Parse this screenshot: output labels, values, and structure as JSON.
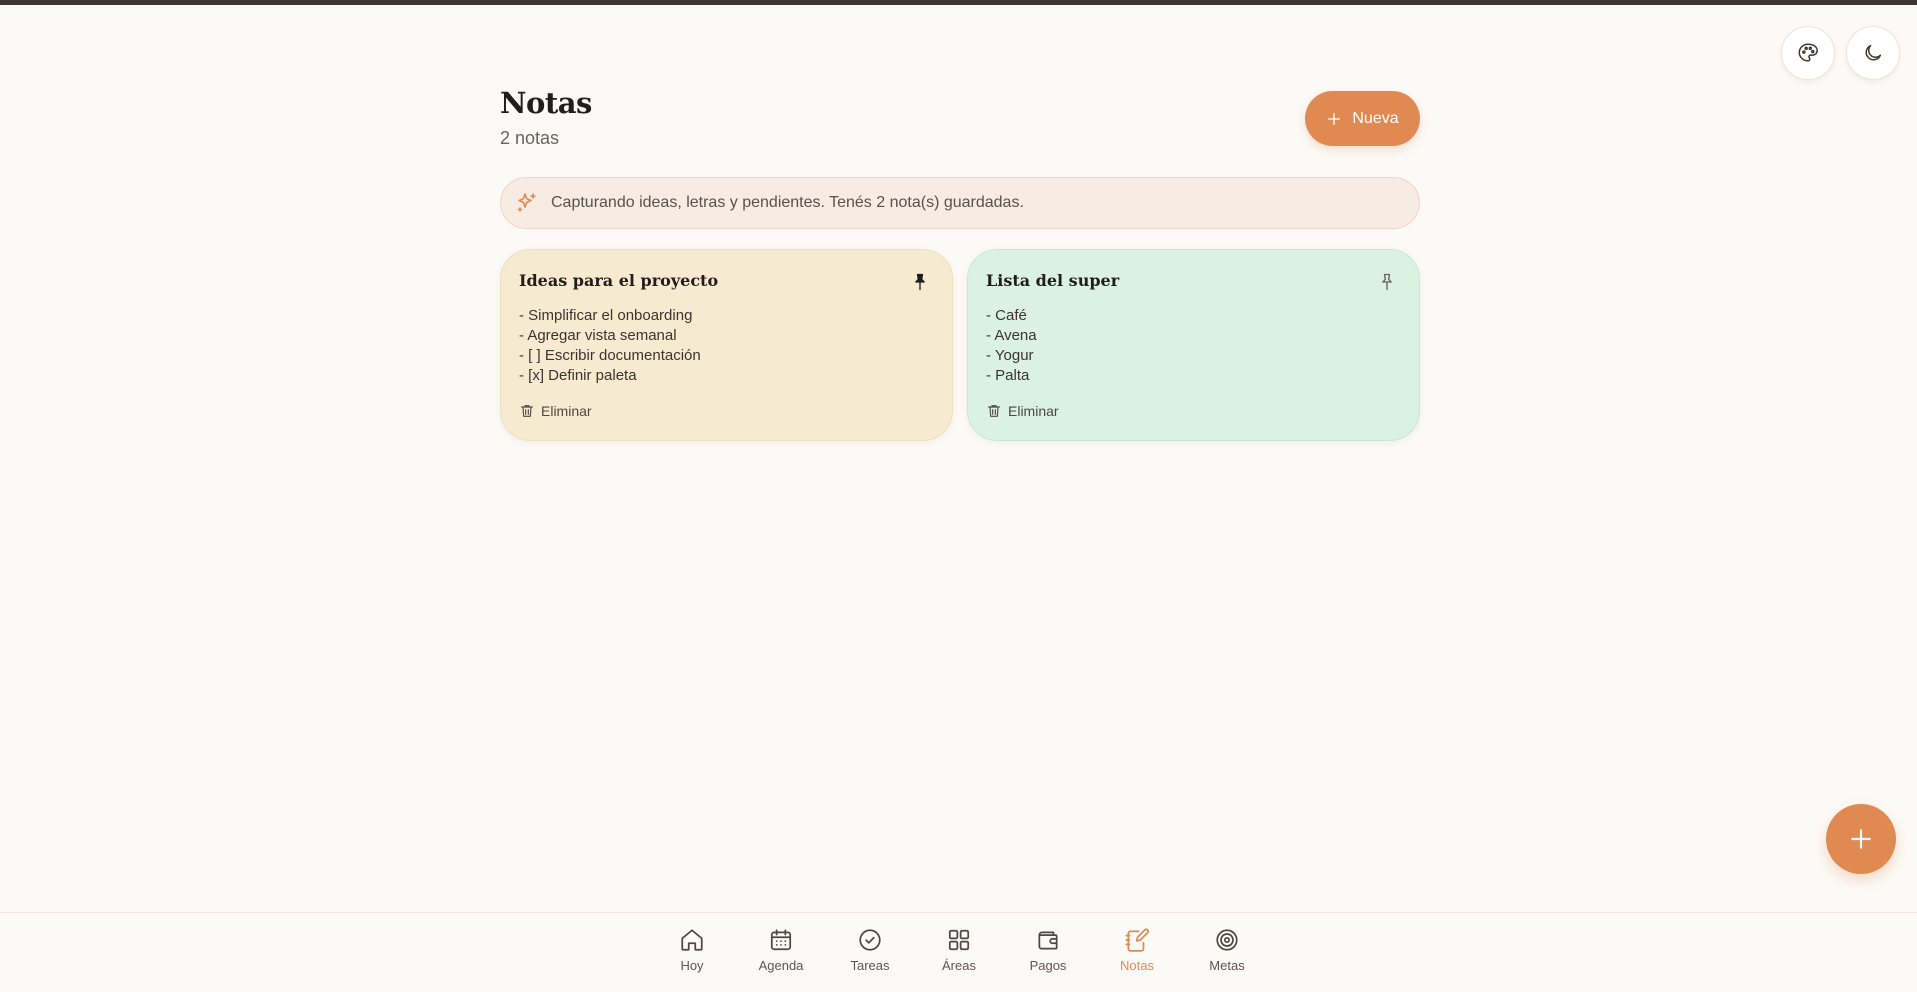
{
  "header": {
    "title": "Notas",
    "subtitle": "2 notas",
    "new_button_label": "Nueva"
  },
  "banner": {
    "text": "Capturando ideas, letras y pendientes. Tenés 2 nota(s) guardadas.",
    "icon": "sparkles-icon"
  },
  "notes": [
    {
      "title": "Ideas para el proyecto",
      "color": "#f6ebd0",
      "pinned": true,
      "lines": [
        "- Simplificar el onboarding",
        "- Agregar vista semanal",
        "- [ ] Escribir documentación",
        "- [x] Definir paleta"
      ],
      "delete_label": "Eliminar"
    },
    {
      "title": "Lista del super",
      "color": "#dbf2e2",
      "pinned": false,
      "lines": [
        "- Café",
        "- Avena",
        "- Yogur",
        "- Palta"
      ],
      "delete_label": "Eliminar"
    }
  ],
  "corner_buttons": [
    {
      "icon": "palette-icon"
    },
    {
      "icon": "moon-icon"
    }
  ],
  "nav": {
    "items": [
      {
        "label": "Hoy",
        "icon": "home-icon"
      },
      {
        "label": "Agenda",
        "icon": "calendar-icon"
      },
      {
        "label": "Tareas",
        "icon": "check-circle-icon"
      },
      {
        "label": "Áreas",
        "icon": "grid-icon"
      },
      {
        "label": "Pagos",
        "icon": "wallet-icon"
      },
      {
        "label": "Notas",
        "icon": "notebook-pen-icon"
      },
      {
        "label": "Metas",
        "icon": "target-icon"
      }
    ],
    "active": "Notas"
  },
  "colors": {
    "accent": "#e08a52",
    "background": "#fcfaf7",
    "text": "#221d19"
  }
}
